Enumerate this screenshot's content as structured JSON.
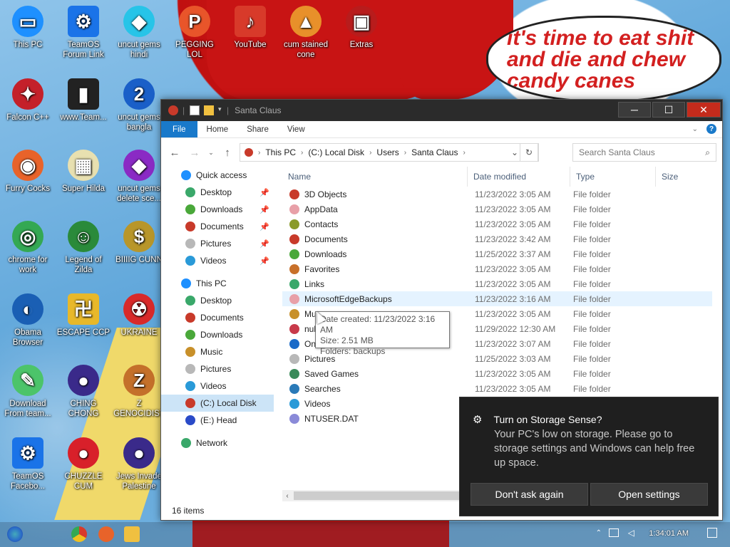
{
  "wallpaper": {
    "speech_text": "it's time to eat shit and die and chew candy canes"
  },
  "desktop_icons": [
    {
      "label": "This PC",
      "color": "#1e90ff",
      "glyph": "▭"
    },
    {
      "label": "TeamOS Forum Link",
      "color": "#1a73e8",
      "glyph": "⚙"
    },
    {
      "label": "uncut gems hindi",
      "color": "#27c4e8",
      "glyph": "◆"
    },
    {
      "label": "PEGGING LOL",
      "color": "#e8552a",
      "glyph": "P"
    },
    {
      "label": "YouTube",
      "color": "#d83a2a",
      "glyph": "♪"
    },
    {
      "label": "cum stained cone",
      "color": "#e8902a",
      "glyph": "▲"
    },
    {
      "label": "Extras",
      "color": "#b81c1c",
      "glyph": "▣"
    },
    {
      "label": "Falcon C++",
      "color": "#c4202a",
      "glyph": "✦"
    },
    {
      "label": "www.Team...",
      "color": "#222222",
      "glyph": "▮"
    },
    {
      "label": "uncut gems bangla",
      "color": "#1a5fc8",
      "glyph": "2"
    },
    {
      "label": "Furry Cocks",
      "color": "#e8632a",
      "glyph": "◉"
    },
    {
      "label": "Super Hilda",
      "color": "#e8e0b0",
      "glyph": "▦"
    },
    {
      "label": "uncut gems delete sce...",
      "color": "#8a2ac4",
      "glyph": "◆"
    },
    {
      "label": "chrome for work",
      "color": "#34a853",
      "glyph": "◎"
    },
    {
      "label": "Legend of Zilda",
      "color": "#2a8a3a",
      "glyph": "☺"
    },
    {
      "label": "BIIIIG CUNN",
      "color": "#b8962a",
      "glyph": "$"
    },
    {
      "label": "Obama Browser",
      "color": "#1a5fb4",
      "glyph": "◐"
    },
    {
      "label": "ESCAPE CCP",
      "color": "#e8b82a",
      "glyph": "卍"
    },
    {
      "label": "UKRAINE",
      "color": "#d82a2a",
      "glyph": "☢"
    },
    {
      "label": "Download From team...",
      "color": "#4cc46a",
      "glyph": "✎"
    },
    {
      "label": "CHING CHONG",
      "color": "#3a2a8a",
      "glyph": "●"
    },
    {
      "label": "Z GENOCIDIST",
      "color": "#c4702a",
      "glyph": "Z"
    },
    {
      "label": "TeamOS Facebo...",
      "color": "#1a73e8",
      "glyph": "⚙"
    },
    {
      "label": "CHUZZLE CUM",
      "color": "#d8202a",
      "glyph": "●"
    },
    {
      "label": "Jews Invade Palestine",
      "color": "#3a2a8a",
      "glyph": "●"
    }
  ],
  "explorer": {
    "title": "Santa Claus",
    "ribbon_tabs": [
      "File",
      "Home",
      "Share",
      "View"
    ],
    "breadcrumb": [
      "This PC",
      "(C:) Local Disk",
      "Users",
      "Santa Claus"
    ],
    "search_placeholder": "Search Santa Claus",
    "columns": [
      "Name",
      "Date modified",
      "Type",
      "Size"
    ],
    "nav": [
      {
        "label": "Quick access",
        "level": 1,
        "color": "#1e90ff",
        "pin": false
      },
      {
        "label": "Desktop",
        "level": 2,
        "color": "#3aa86a",
        "pin": true
      },
      {
        "label": "Downloads",
        "level": 2,
        "color": "#4aa83a",
        "pin": true
      },
      {
        "label": "Documents",
        "level": 2,
        "color": "#c83a2a",
        "pin": true
      },
      {
        "label": "Pictures",
        "level": 2,
        "color": "#b8b8b8",
        "pin": true
      },
      {
        "label": "Videos",
        "level": 2,
        "color": "#2a9ad8",
        "pin": true
      },
      {
        "label": "This PC",
        "level": 1,
        "color": "#1e90ff",
        "pin": false
      },
      {
        "label": "Desktop",
        "level": 2,
        "color": "#3aa86a",
        "pin": false
      },
      {
        "label": "Documents",
        "level": 2,
        "color": "#c83a2a",
        "pin": false
      },
      {
        "label": "Downloads",
        "level": 2,
        "color": "#4aa83a",
        "pin": false
      },
      {
        "label": "Music",
        "level": 2,
        "color": "#c8902a",
        "pin": false
      },
      {
        "label": "Pictures",
        "level": 2,
        "color": "#b8b8b8",
        "pin": false
      },
      {
        "label": "Videos",
        "level": 2,
        "color": "#2a9ad8",
        "pin": false
      },
      {
        "label": "(C:) Local Disk",
        "level": 2,
        "color": "#c83a2a",
        "pin": false,
        "selected": true
      },
      {
        "label": "(E:) Head",
        "level": 2,
        "color": "#2a4ac8",
        "pin": false
      },
      {
        "label": "Network",
        "level": 1,
        "color": "#3aa86a",
        "pin": false
      }
    ],
    "files": [
      {
        "name": "3D Objects",
        "date": "11/23/2022 3:05 AM",
        "type": "File folder",
        "color": "#c83a2a"
      },
      {
        "name": "AppData",
        "date": "11/23/2022 3:05 AM",
        "type": "File folder",
        "color": "#e8a0a8"
      },
      {
        "name": "Contacts",
        "date": "11/23/2022 3:05 AM",
        "type": "File folder",
        "color": "#8a9a2a"
      },
      {
        "name": "Documents",
        "date": "11/23/2022 3:42 AM",
        "type": "File folder",
        "color": "#c83a2a"
      },
      {
        "name": "Downloads",
        "date": "11/25/2022 3:37 AM",
        "type": "File folder",
        "color": "#4aa83a"
      },
      {
        "name": "Favorites",
        "date": "11/23/2022 3:05 AM",
        "type": "File folder",
        "color": "#c8702a"
      },
      {
        "name": "Links",
        "date": "11/23/2022 3:05 AM",
        "type": "File folder",
        "color": "#3aa86a"
      },
      {
        "name": "MicrosoftEdgeBackups",
        "date": "11/23/2022 3:16 AM",
        "type": "File folder",
        "color": "#e8a0a8",
        "hover": true
      },
      {
        "name": "Mu",
        "date": "11/23/2022 3:05 AM",
        "type": "File folder",
        "color": "#c8902a"
      },
      {
        "name": "nul",
        "date": "11/29/2022 12:30 AM",
        "type": "File folder",
        "color": "#c83a4a"
      },
      {
        "name": "OneDrive",
        "date": "11/23/2022 3:07 AM",
        "type": "File folder",
        "color": "#1a6ac8"
      },
      {
        "name": "Pictures",
        "date": "11/25/2022 3:03 AM",
        "type": "File folder",
        "color": "#b8b8b8"
      },
      {
        "name": "Saved Games",
        "date": "11/23/2022 3:05 AM",
        "type": "File folder",
        "color": "#3a8a5a"
      },
      {
        "name": "Searches",
        "date": "11/23/2022 3:05 AM",
        "type": "File folder",
        "color": "#2a7ab8"
      },
      {
        "name": "Videos",
        "date": "11/23/2022 3:05 AM",
        "type": "File folder",
        "color": "#2a9ad8"
      },
      {
        "name": "NTUSER.DAT",
        "date": "",
        "type": "",
        "color": "#8a8ad8"
      }
    ],
    "tooltip": [
      "Date created: 11/23/2022 3:16 AM",
      "Size: 2.51 MB",
      "Folders: backups"
    ],
    "status": "16 items"
  },
  "toast": {
    "title": "Turn on Storage Sense?",
    "body": "Your PC's low on storage. Please go to storage settings and Windows can help free up space.",
    "btn_dismiss": "Don't ask again",
    "btn_open": "Open settings"
  },
  "taskbar": {
    "clock": "1:34:01 AM"
  }
}
